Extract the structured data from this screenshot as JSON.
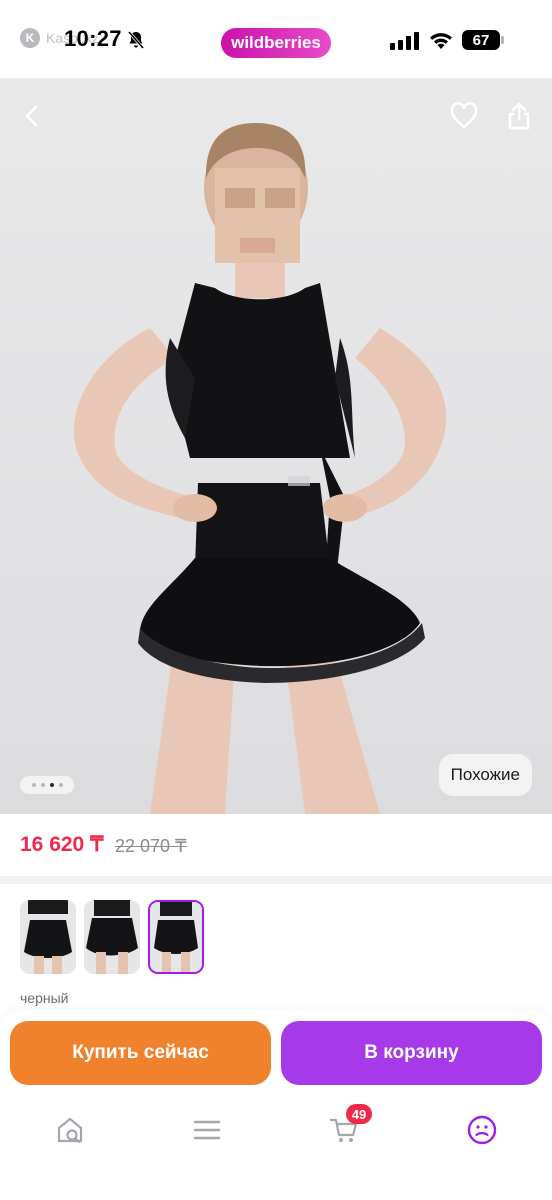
{
  "status_bar": {
    "back_app": "Kaspi.kz",
    "time": "10:27",
    "brand": "wildberries",
    "battery": "67"
  },
  "product": {
    "similar_label": "Похожие",
    "gallery_total": 4,
    "gallery_active_index": 2
  },
  "price": {
    "current": "16 620 ₸",
    "old": "22 070 ₸"
  },
  "colors": {
    "selected_label": "черный",
    "thumbnails_count": 3,
    "selected_index": 2
  },
  "actions": {
    "buy_now_label": "Купить сейчас",
    "add_to_cart_label": "В корзину"
  },
  "bottom_nav": {
    "cart_count": "49"
  },
  "theme": {
    "brand_pink": "#cb11ab",
    "price_red": "#f0294a",
    "buy_orange": "#f0822d",
    "cart_purple": "#a63ae8"
  }
}
